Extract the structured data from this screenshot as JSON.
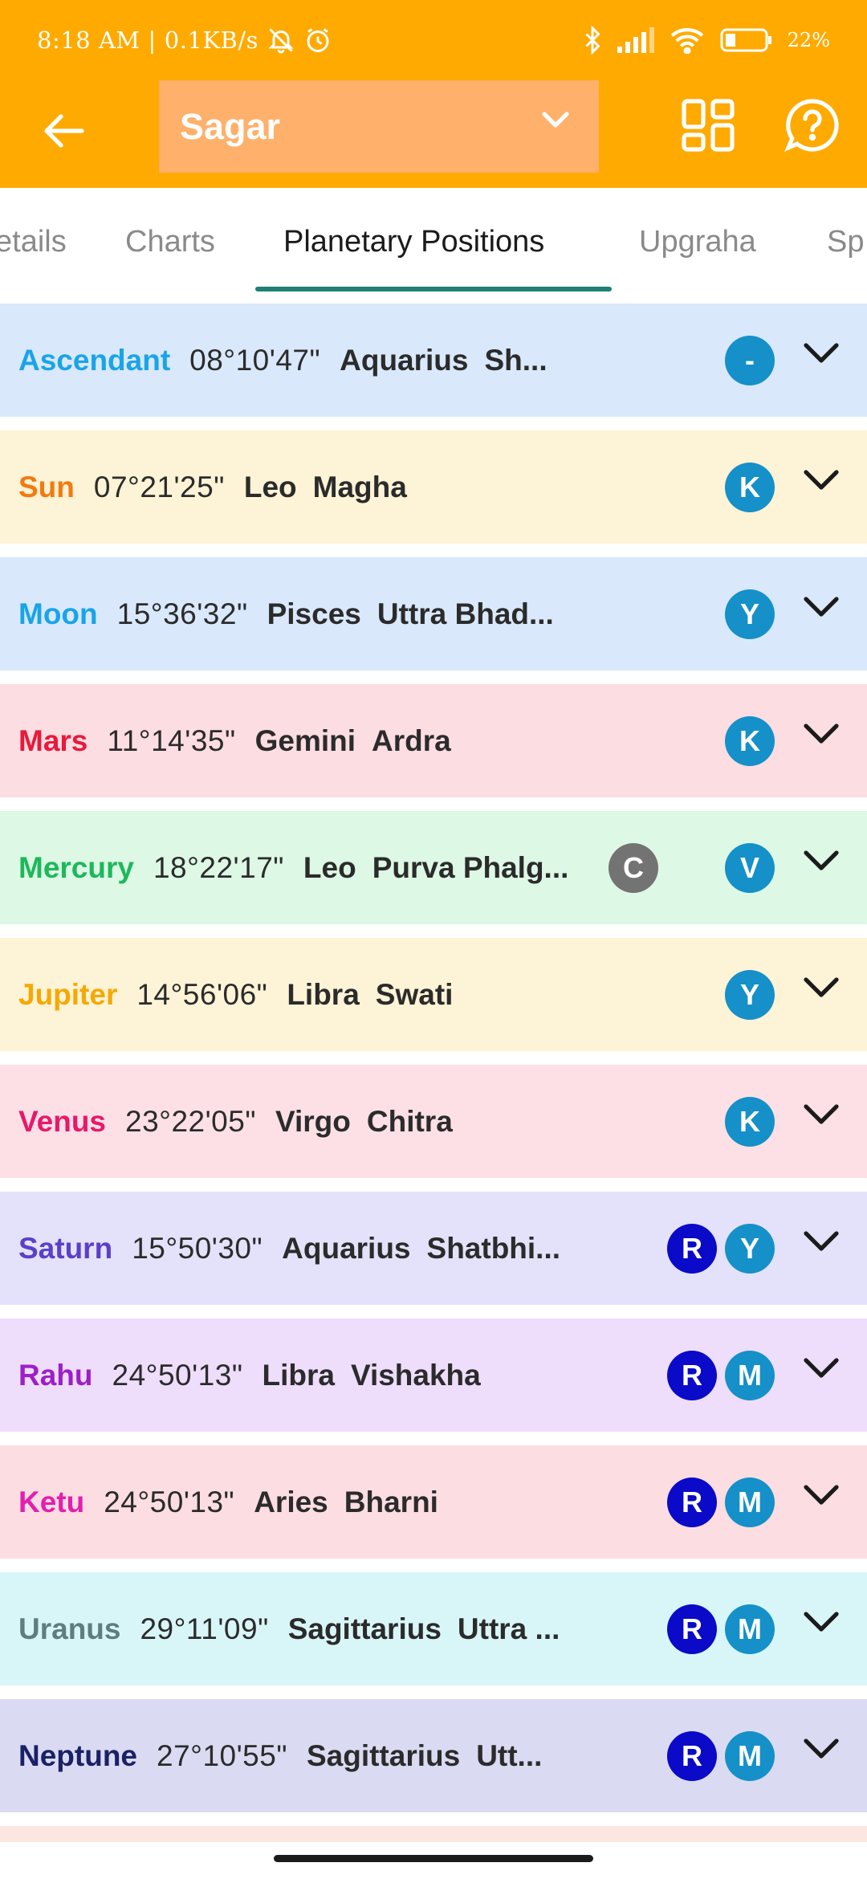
{
  "status_bar": {
    "time": "8:18 AM",
    "speed": "0.1KB/s",
    "battery": "22%"
  },
  "toolbar": {
    "profile_name": "Sagar"
  },
  "tabs": [
    {
      "label": "Details",
      "visible_text": "etails"
    },
    {
      "label": "Charts",
      "visible_text": "Charts"
    },
    {
      "label": "Planetary Positions",
      "visible_text": "Planetary Positions",
      "active": true
    },
    {
      "label": "Upgraha",
      "visible_text": "Upgraha"
    },
    {
      "label": "Sp",
      "visible_text": "Sp"
    }
  ],
  "planets": [
    {
      "name": "Ascendant",
      "degree": "08°10'47\"",
      "sign": "Aquarius",
      "nakshatra": "Sh...",
      "badges": [
        "-"
      ],
      "name_color": "#1AA4E8",
      "bg": "#D9E8FB"
    },
    {
      "name": "Sun",
      "degree": "07°21'25\"",
      "sign": "Leo",
      "nakshatra": "Magha",
      "badges": [
        "K"
      ],
      "name_color": "#F27A10",
      "bg": "#FDF3D6"
    },
    {
      "name": "Moon",
      "degree": "15°36'32\"",
      "sign": "Pisces",
      "nakshatra": "Uttra Bhad...",
      "badges": [
        "Y"
      ],
      "name_color": "#1AA4E8",
      "bg": "#D9E8FB"
    },
    {
      "name": "Mars",
      "degree": "11°14'35\"",
      "sign": "Gemini",
      "nakshatra": "Ardra",
      "badges": [
        "K"
      ],
      "name_color": "#E8193A",
      "bg": "#FCDDE2"
    },
    {
      "name": "Mercury",
      "degree": "18°22'17\"",
      "sign": "Leo",
      "nakshatra": "Purva Phalg...",
      "badges": [
        "C",
        "V"
      ],
      "name_color": "#1DB85C",
      "bg": "#DDF8E4"
    },
    {
      "name": "Jupiter",
      "degree": "14°56'06\"",
      "sign": "Libra",
      "nakshatra": "Swati",
      "badges": [
        "Y"
      ],
      "name_color": "#F5A800",
      "bg": "#FDF3D6"
    },
    {
      "name": "Venus",
      "degree": "23°22'05\"",
      "sign": "Virgo",
      "nakshatra": "Chitra",
      "badges": [
        "K"
      ],
      "name_color": "#E6196A",
      "bg": "#FCE0E6"
    },
    {
      "name": "Saturn",
      "degree": "15°50'30\"",
      "sign": "Aquarius",
      "nakshatra": "Shatbhi...",
      "badges": [
        "R",
        "Y"
      ],
      "name_color": "#5B3FC8",
      "bg": "#E4E2FA"
    },
    {
      "name": "Rahu",
      "degree": "24°50'13\"",
      "sign": "Libra",
      "nakshatra": "Vishakha",
      "badges": [
        "R",
        "M"
      ],
      "name_color": "#9C1FC8",
      "bg": "#EEDDFB"
    },
    {
      "name": "Ketu",
      "degree": "24°50'13\"",
      "sign": "Aries",
      "nakshatra": "Bharni",
      "badges": [
        "R",
        "M"
      ],
      "name_color": "#E41EB0",
      "bg": "#FCDDE2"
    },
    {
      "name": "Uranus",
      "degree": "29°11'09\"",
      "sign": "Sagittarius",
      "nakshatra": "Uttra ...",
      "badges": [
        "R",
        "M"
      ],
      "name_color": "#5F7D80",
      "bg": "#D8F6F8"
    },
    {
      "name": "Neptune",
      "degree": "27°10'55\"",
      "sign": "Sagittarius",
      "nakshatra": "Utt...",
      "badges": [
        "R",
        "M"
      ],
      "name_color": "#1A2166",
      "bg": "#DADBF2"
    }
  ],
  "colors": {
    "appbar": "#FFAA00",
    "selector": "#FFB06B",
    "tab_indicator": "#1E7F74",
    "badge_blue": "#1590C8",
    "badge_retro": "#0A0AC8",
    "badge_combust": "#737373"
  },
  "icons": {
    "back": "arrow-left-icon",
    "dropdown": "chevron-down-icon",
    "layout": "grid-layout-icon",
    "help": "help-circle-icon",
    "row_expand": "chevron-down-icon"
  }
}
